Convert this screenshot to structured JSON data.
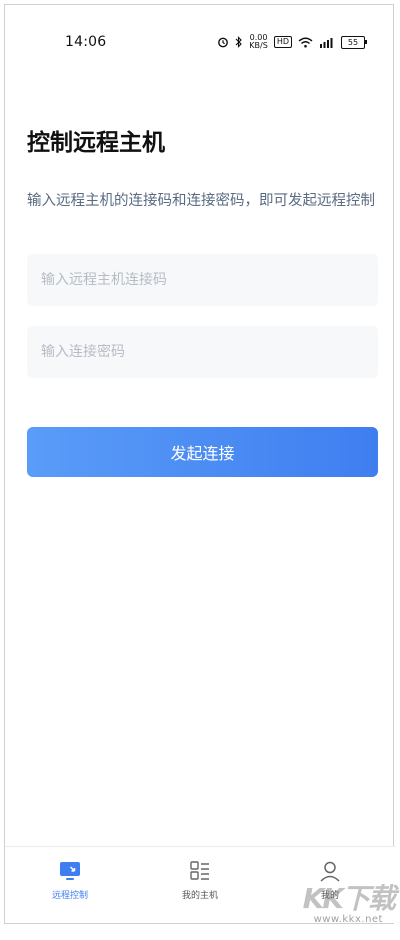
{
  "status_bar": {
    "time": "14:06",
    "net_speed_value": "0.00",
    "net_speed_unit": "KB/S",
    "hd_label": "HD",
    "battery": "55"
  },
  "page": {
    "title": "控制远程主机",
    "description": "输入远程主机的连接码和连接密码，即可发起远程控制"
  },
  "form": {
    "code_placeholder": "输入远程主机连接码",
    "password_placeholder": "输入连接密码",
    "submit_label": "发起连接"
  },
  "tab_bar": {
    "items": [
      {
        "label": "远程控制",
        "icon": "monitor-icon",
        "active": true
      },
      {
        "label": "我的主机",
        "icon": "host-list-icon",
        "active": false
      },
      {
        "label": "我的",
        "icon": "user-icon",
        "active": false
      }
    ]
  },
  "colors": {
    "accent": "#3f7ef0",
    "description_text": "#5a6b82",
    "input_background": "#f7f8fa"
  },
  "watermark": {
    "logo": "KK下载",
    "url": "www.kkx.net"
  }
}
